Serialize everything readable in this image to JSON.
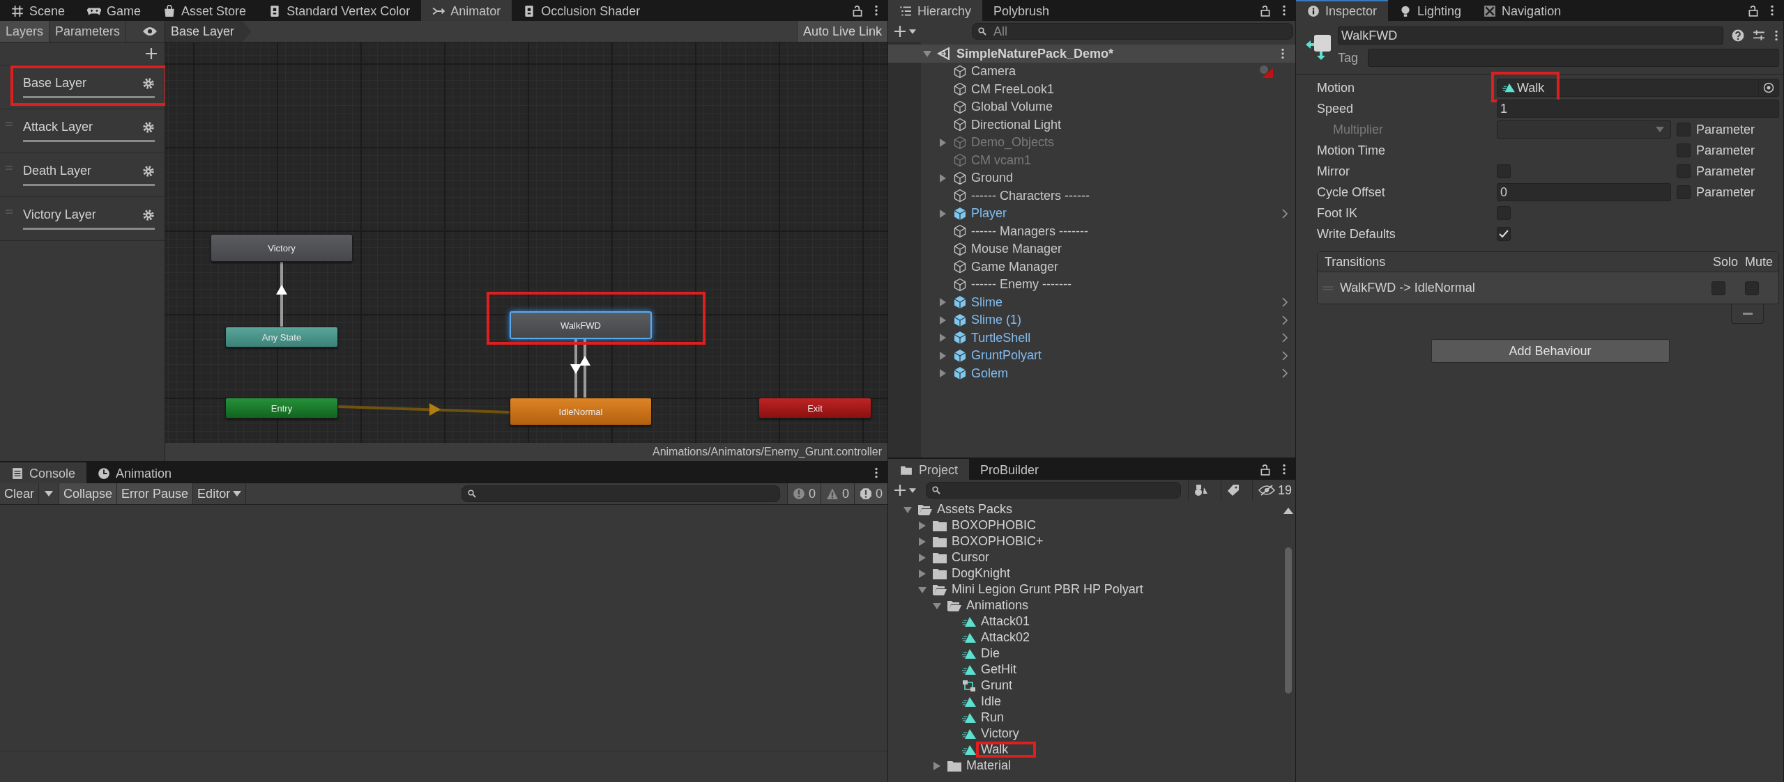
{
  "animator_tabs": [
    {
      "label": "Scene",
      "selected": false
    },
    {
      "label": "Game",
      "selected": false
    },
    {
      "label": "Asset Store",
      "selected": false
    },
    {
      "label": "Standard Vertex Color",
      "selected": false
    },
    {
      "label": "Animator",
      "selected": true
    },
    {
      "label": "Occlusion Shader",
      "selected": false
    }
  ],
  "animator": {
    "panel_tabs": [
      {
        "label": "Layers",
        "selected": true
      },
      {
        "label": "Parameters",
        "selected": false
      }
    ],
    "breadcrumb": "Base Layer",
    "live_link_button": "Auto Live Link",
    "layers": [
      {
        "name": "Base Layer",
        "level": 1,
        "highlighted": true
      },
      {
        "name": "Attack Layer",
        "level": 1,
        "highlighted": false
      },
      {
        "name": "Death Layer",
        "level": 1,
        "highlighted": false
      },
      {
        "name": "Victory Layer",
        "level": 1,
        "highlighted": false
      }
    ],
    "states": [
      {
        "name": "Victory",
        "kind": "state",
        "selected": false,
        "highlighted": false
      },
      {
        "name": "Any State",
        "kind": "any",
        "selected": false,
        "highlighted": false
      },
      {
        "name": "WalkFWD",
        "kind": "state",
        "selected": true,
        "highlighted": true
      },
      {
        "name": "Entry",
        "kind": "entry",
        "selected": false,
        "highlighted": false
      },
      {
        "name": "IdleNormal",
        "kind": "default",
        "selected": false,
        "highlighted": false
      },
      {
        "name": "Exit",
        "kind": "exit",
        "selected": false,
        "highlighted": false
      }
    ],
    "controller_path": "Animations/Animators/Enemy_Grunt.controller"
  },
  "console": {
    "tabs": [
      {
        "label": "Console",
        "selected": true
      },
      {
        "label": "Animation",
        "selected": false
      }
    ],
    "clear_button": "Clear",
    "toggles": [
      {
        "label": "Collapse",
        "on": true
      },
      {
        "label": "Error Pause",
        "on": true
      }
    ],
    "editor_dropdown": "Editor",
    "counts": [
      "0",
      "0",
      "0"
    ]
  },
  "hierarchy": {
    "tabs": [
      {
        "label": "Hierarchy",
        "selected": true
      },
      {
        "label": "Polybrush",
        "selected": false
      }
    ],
    "search_placeholder": "All",
    "scene": {
      "name": "SimpleNaturePack_Demo*",
      "expanded": true
    },
    "items": [
      {
        "name": "Camera",
        "kind": "object",
        "active": true,
        "expandable": false,
        "warning": true
      },
      {
        "name": "CM FreeLook1",
        "kind": "object",
        "active": true,
        "expandable": false,
        "warning": false
      },
      {
        "name": "Global Volume",
        "kind": "object",
        "active": true,
        "expandable": false,
        "warning": false
      },
      {
        "name": "Directional Light",
        "kind": "object",
        "active": true,
        "expandable": false,
        "warning": false
      },
      {
        "name": "Demo_Objects",
        "kind": "object",
        "active": false,
        "expandable": true,
        "warning": false
      },
      {
        "name": "CM vcam1",
        "kind": "object",
        "active": false,
        "expandable": false,
        "warning": false
      },
      {
        "name": "Ground",
        "kind": "object",
        "active": true,
        "expandable": true,
        "warning": false
      },
      {
        "name": "------ Characters ------",
        "kind": "object",
        "active": true,
        "expandable": false,
        "warning": false
      },
      {
        "name": "Player",
        "kind": "prefab",
        "active": true,
        "expandable": true,
        "warning": false
      },
      {
        "name": "------ Managers -------",
        "kind": "object",
        "active": true,
        "expandable": false,
        "warning": false
      },
      {
        "name": "Mouse Manager",
        "kind": "object",
        "active": true,
        "expandable": false,
        "warning": false
      },
      {
        "name": "Game Manager",
        "kind": "object",
        "active": true,
        "expandable": false,
        "warning": false
      },
      {
        "name": "------ Enemy -------",
        "kind": "object",
        "active": true,
        "expandable": false,
        "warning": false
      },
      {
        "name": "Slime",
        "kind": "prefab",
        "active": true,
        "expandable": true,
        "warning": false
      },
      {
        "name": "Slime (1)",
        "kind": "prefab",
        "active": true,
        "expandable": true,
        "warning": false
      },
      {
        "name": "TurtleShell",
        "kind": "prefab",
        "active": true,
        "expandable": true,
        "warning": false
      },
      {
        "name": "GruntPolyart",
        "kind": "prefab",
        "active": true,
        "expandable": true,
        "warning": false
      },
      {
        "name": "Golem",
        "kind": "prefab",
        "active": true,
        "expandable": true,
        "warning": false
      }
    ]
  },
  "project": {
    "tabs": [
      {
        "label": "Project",
        "selected": true
      },
      {
        "label": "ProBuilder",
        "selected": false
      }
    ],
    "hidden_count": "19",
    "tree": [
      {
        "name": "Assets Packs",
        "kind": "folder",
        "expanded": true,
        "highlighted": false,
        "children": [
          {
            "name": "BOXOPHOBIC",
            "kind": "folder",
            "expanded": false,
            "highlighted": false
          },
          {
            "name": "BOXOPHOBIC+",
            "kind": "folder",
            "expanded": false,
            "highlighted": false
          },
          {
            "name": "Cursor",
            "kind": "folder",
            "expanded": false,
            "highlighted": false
          },
          {
            "name": "DogKnight",
            "kind": "folder",
            "expanded": false,
            "highlighted": false
          },
          {
            "name": "Mini Legion Grunt PBR HP Polyart",
            "kind": "folder",
            "expanded": true,
            "highlighted": false,
            "children": [
              {
                "name": "Animations",
                "kind": "folder",
                "expanded": true,
                "highlighted": false,
                "children": [
                  {
                    "name": "Attack01",
                    "kind": "clip",
                    "highlighted": false
                  },
                  {
                    "name": "Attack02",
                    "kind": "clip",
                    "highlighted": false
                  },
                  {
                    "name": "Die",
                    "kind": "clip",
                    "highlighted": false
                  },
                  {
                    "name": "GetHit",
                    "kind": "clip",
                    "highlighted": false
                  },
                  {
                    "name": "Grunt",
                    "kind": "controller",
                    "highlighted": false
                  },
                  {
                    "name": "Idle",
                    "kind": "clip",
                    "highlighted": false
                  },
                  {
                    "name": "Run",
                    "kind": "clip",
                    "highlighted": false
                  },
                  {
                    "name": "Victory",
                    "kind": "clip",
                    "highlighted": false
                  },
                  {
                    "name": "Walk",
                    "kind": "clip",
                    "highlighted": true
                  }
                ]
              },
              {
                "name": "Material",
                "kind": "folder",
                "expanded": false,
                "highlighted": false
              }
            ]
          }
        ]
      }
    ]
  },
  "inspector": {
    "tabs": [
      {
        "label": "Inspector",
        "selected": true
      },
      {
        "label": "Lighting",
        "selected": false
      },
      {
        "label": "Navigation",
        "selected": false
      }
    ],
    "name": "WalkFWD",
    "tag_label": "Tag",
    "properties": [
      {
        "label": "Motion",
        "kind": "object",
        "value": "Walk",
        "highlighted": true,
        "disabled": false
      },
      {
        "label": "Speed",
        "kind": "number",
        "value": "1",
        "disabled": false
      },
      {
        "label": "Multiplier",
        "kind": "dropdown",
        "disabled": true,
        "parameter": {
          "label": "Parameter",
          "checked": false
        }
      },
      {
        "label": "Motion Time",
        "kind": "empty",
        "disabled": false,
        "parameter": {
          "label": "Parameter",
          "checked": false
        }
      },
      {
        "label": "Mirror",
        "kind": "checkbox",
        "checked": false,
        "disabled": false,
        "parameter": {
          "label": "Parameter",
          "checked": false
        }
      },
      {
        "label": "Cycle Offset",
        "kind": "number",
        "value": "0",
        "disabled": false,
        "parameter": {
          "label": "Parameter",
          "checked": false
        }
      },
      {
        "label": "Foot IK",
        "kind": "checkbox",
        "checked": false,
        "disabled": false
      },
      {
        "label": "Write Defaults",
        "kind": "checkbox",
        "checked": true,
        "disabled": false
      }
    ],
    "transitions": {
      "heading": "Transitions",
      "solo_label": "Solo",
      "mute_label": "Mute",
      "items": [
        {
          "label": "WalkFWD -> IdleNormal",
          "solo": false,
          "mute": false
        }
      ]
    },
    "add_button": "Add Behaviour"
  }
}
